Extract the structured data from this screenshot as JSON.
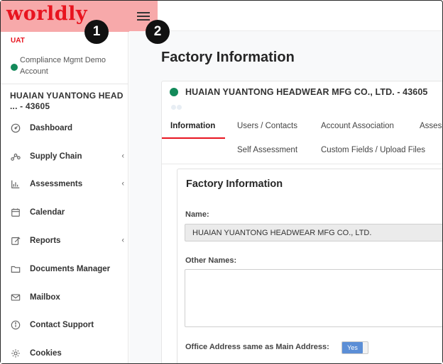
{
  "brand": {
    "logo": "worldly",
    "environment": "UAT"
  },
  "account": {
    "name": "Compliance Mgmt Demo Account",
    "status_color": "#138a5a"
  },
  "factory": {
    "short_name": "HUAIAN YUANTONG HEAD ... - 43605",
    "header_name": "HUAIAN YUANTONG HEADWEAR MFG CO., LTD. - 43605"
  },
  "sidebar": {
    "items": [
      {
        "label": "Dashboard",
        "icon": "dashboard-icon",
        "chevron": false
      },
      {
        "label": "Supply Chain",
        "icon": "supply-chain-icon",
        "chevron": true
      },
      {
        "label": "Assessments",
        "icon": "bar-chart-icon",
        "chevron": true
      },
      {
        "label": "Calendar",
        "icon": "calendar-icon",
        "chevron": false
      },
      {
        "label": "Reports",
        "icon": "edit-icon",
        "chevron": true
      },
      {
        "label": "Documents Manager",
        "icon": "folder-icon",
        "chevron": false
      },
      {
        "label": "Mailbox",
        "icon": "mail-icon",
        "chevron": false
      },
      {
        "label": "Contact Support",
        "icon": "info-icon",
        "chevron": false
      },
      {
        "label": "Cookies",
        "icon": "gear-icon",
        "chevron": false
      }
    ]
  },
  "callouts": {
    "one": "1",
    "two": "2"
  },
  "page": {
    "title": "Factory Information"
  },
  "tabs": [
    {
      "label": "Information",
      "active": true
    },
    {
      "label": "Users / Contacts",
      "active": false
    },
    {
      "label": "Account Association",
      "active": false
    },
    {
      "label": "Assess",
      "active": false
    },
    {
      "label": "Self Assessment",
      "active": false
    },
    {
      "label": "Custom Fields / Upload Files",
      "active": false
    }
  ],
  "section": {
    "title": "Factory Information",
    "name_label": "Name:",
    "name_value": "HUAIAN YUANTONG HEADWEAR MFG CO., LTD.",
    "other_names_label": "Other Names:",
    "office_label": "Office Address same as Main Address:",
    "toggle_value": "Yes"
  },
  "colors": {
    "brand_red": "#e8141f",
    "highlight": "#f7a9aa",
    "toggle_blue": "#5b8ed6"
  }
}
